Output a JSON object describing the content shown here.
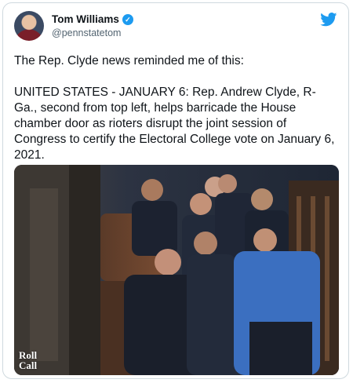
{
  "author": {
    "name": "Tom Williams",
    "handle": "@pennstatetom",
    "verified": true,
    "avatar_icon": "avatar"
  },
  "tweet": {
    "text": "The Rep. Clyde news reminded me of this:\n\nUNITED STATES - JANUARY 6: Rep. Andrew Clyde, R-Ga., second from top left, helps barricade the House chamber door as rioters disrupt the joint session of Congress to certify the Electoral College vote on January 6, 2021."
  },
  "media": {
    "credit": "Roll\nCall"
  },
  "icons": {
    "brand": "twitter-bird-icon",
    "verified": "verified-badge-icon"
  },
  "colors": {
    "brand_blue": "#1d9bf0",
    "text": "#0f1419",
    "muted": "#536471"
  }
}
